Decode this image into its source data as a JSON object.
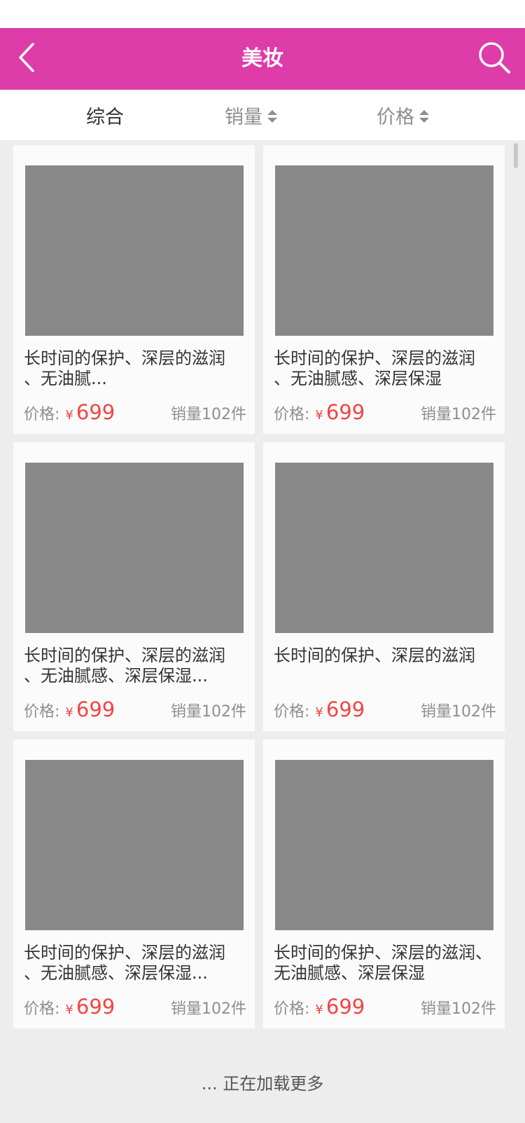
{
  "header": {
    "title": "美妆",
    "background": "#dd3ca9"
  },
  "sort_tabs": [
    {
      "label": "综合",
      "active": true
    },
    {
      "label": "销量",
      "has_arrows": true
    },
    {
      "label": "价格",
      "has_arrows": true
    }
  ],
  "products": [
    {
      "title": "长时间的保护、深层的滋润\n、无油腻...",
      "price_label": "价格:",
      "currency": "¥",
      "price": "699",
      "sales": "销量102件"
    },
    {
      "title": "长时间的保护、深层的滋润\n、无油腻感、深层保湿",
      "price_label": "价格:",
      "currency": "¥",
      "price": "699",
      "sales": "销量102件"
    },
    {
      "title": "长时间的保护、深层的滋润\n、无油腻感、深层保湿...",
      "price_label": "价格:",
      "currency": "¥",
      "price": "699",
      "sales": "销量102件"
    },
    {
      "title": "长时间的保护、深层的滋润",
      "price_label": "价格:",
      "currency": "¥",
      "price": "699",
      "sales": "销量102件"
    },
    {
      "title": "长时间的保护、深层的滋润\n、无油腻感、深层保湿...",
      "price_label": "价格:",
      "currency": "¥",
      "price": "699",
      "sales": "销量102件"
    },
    {
      "title": "长时间的保护、深层的滋润、\n无油腻感、深层保湿",
      "price_label": "价格:",
      "currency": "¥",
      "price": "699",
      "sales": "销量102件"
    }
  ],
  "footer": {
    "loading_text": "... 正在加载更多"
  },
  "colors": {
    "accent": "#dd3ca9",
    "price": "#f24545",
    "image_placeholder": "#888888"
  }
}
